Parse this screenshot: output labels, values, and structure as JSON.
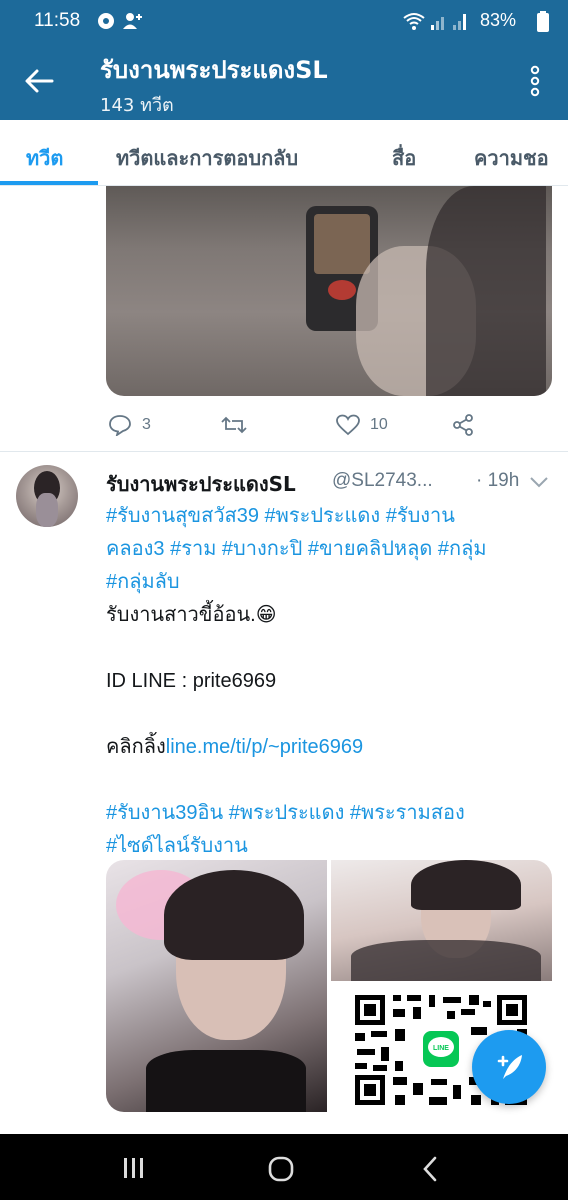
{
  "status_bar": {
    "time": "11:58",
    "battery": "83%",
    "icons": [
      "settings-gear-icon",
      "person-add-icon",
      "wifi-icon",
      "signal-icon",
      "signal-icon",
      "battery-icon"
    ]
  },
  "header": {
    "title": "รับงานพระประแดงSL",
    "subtitle": "143 ทวีต",
    "back_icon": "arrow-left-icon",
    "menu_icon": "more-vertical-icon",
    "background": "#1d6a9a"
  },
  "tabs": [
    {
      "label": "ทวีต",
      "active": true
    },
    {
      "label": "ทวีตและการตอบกลับ",
      "active": false
    },
    {
      "label": "สื่อ",
      "active": false
    },
    {
      "label": "ความชอ",
      "active": false
    }
  ],
  "tweet1": {
    "actions": {
      "replies": "3",
      "retweets": "",
      "likes": "10"
    }
  },
  "tweet2": {
    "name": "รับงานพระประแดงSL",
    "handle": "@SL2743...",
    "time": "· 19h",
    "lines": [
      {
        "type": "tags",
        "text": "#รับงานสุขสวัส39 #พระประแดง #รับงาน"
      },
      {
        "type": "tags",
        "text": "คลอง3 #ราม #บางกะปิ #ขายคลิปหลุด #กลุ่ม"
      },
      {
        "type": "tags",
        "text": "#กลุ่มลับ"
      },
      {
        "type": "text",
        "text": "รับงานสาวขี้อ้อน.😁"
      },
      {
        "type": "blank",
        "text": ""
      },
      {
        "type": "text",
        "text": "ID LINE : prite6969"
      },
      {
        "type": "blank",
        "text": ""
      },
      {
        "type": "mixed",
        "prefix": "คลิกลิ้ง",
        "link": "line.me/ti/p/~prite6969"
      },
      {
        "type": "blank",
        "text": ""
      },
      {
        "type": "tags",
        "text": "#รับงาน39อิน #พระประแดง #พระรามสอง"
      },
      {
        "type": "tags",
        "text": "#ไซด์ไลน์รับงาน"
      }
    ],
    "qr_badge": "LINE"
  },
  "colors": {
    "accent": "#1d9bf0",
    "link": "#1b95e0",
    "muted": "#657786"
  }
}
